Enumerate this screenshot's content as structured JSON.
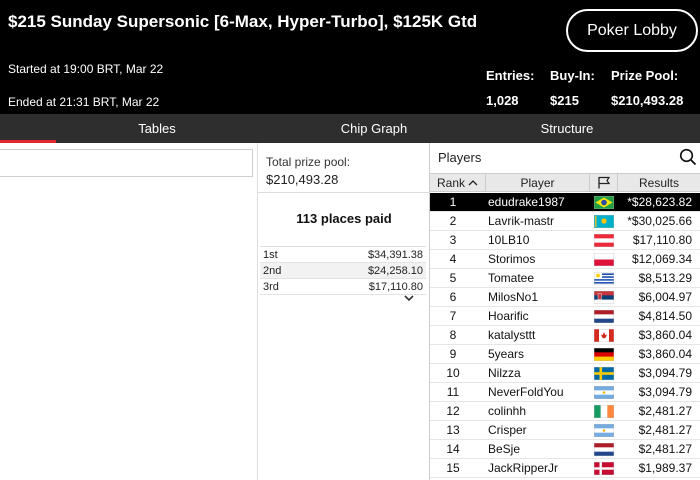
{
  "header": {
    "title": "$215 Sunday Supersonic [6-Max, Hyper-Turbo], $125K Gtd",
    "started": "Started at 19:00 BRT, Mar 22",
    "ended": "Ended at 21:31 BRT, Mar 22",
    "lobby_button": "Poker Lobby",
    "stats": {
      "entries_label": "Entries:",
      "entries_value": "1,028",
      "buyin_label": "Buy-In:",
      "buyin_value": "$215",
      "pool_label": "Prize Pool:",
      "pool_value": "$210,493.28"
    }
  },
  "tabs": [
    "Tables",
    "Chip Graph",
    "Structure"
  ],
  "active_tab": "Tables",
  "prize": {
    "total_label": "Total prize pool:",
    "total_value": "$210,493.28",
    "places_paid": "113 places paid",
    "places": [
      {
        "place": "1st",
        "amount": "$34,391.38"
      },
      {
        "place": "2nd",
        "amount": "$24,258.10"
      },
      {
        "place": "3rd",
        "amount": "$17,110.80"
      }
    ]
  },
  "players": {
    "title": "Players",
    "columns": {
      "rank": "Rank",
      "player": "Player",
      "results": "Results"
    },
    "rows": [
      {
        "rank": "1",
        "name": "edudrake1987",
        "flag": "brazil",
        "result": "*$28,623.82"
      },
      {
        "rank": "2",
        "name": "Lavrik-mastr",
        "flag": "kazakhstan",
        "result": "*$30,025.66"
      },
      {
        "rank": "3",
        "name": "10LB10",
        "flag": "austria",
        "result": "$17,110.80"
      },
      {
        "rank": "4",
        "name": "Storimos",
        "flag": "poland",
        "result": "$12,069.34"
      },
      {
        "rank": "5",
        "name": "Tomatee",
        "flag": "uruguay",
        "result": "$8,513.29"
      },
      {
        "rank": "6",
        "name": "MilosNo1",
        "flag": "serbia",
        "result": "$6,004.97"
      },
      {
        "rank": "7",
        "name": "Hoarific",
        "flag": "netherlands",
        "result": "$4,814.50"
      },
      {
        "rank": "8",
        "name": "katalysttt",
        "flag": "canada",
        "result": "$3,860.04"
      },
      {
        "rank": "9",
        "name": "5years",
        "flag": "germany",
        "result": "$3,860.04"
      },
      {
        "rank": "10",
        "name": "Nilzza",
        "flag": "sweden",
        "result": "$3,094.79"
      },
      {
        "rank": "11",
        "name": "NeverFoldYou",
        "flag": "argentina",
        "result": "$3,094.79"
      },
      {
        "rank": "12",
        "name": "colinhh",
        "flag": "ireland",
        "result": "$2,481.27"
      },
      {
        "rank": "13",
        "name": "Crisper",
        "flag": "argentina",
        "result": "$2,481.27"
      },
      {
        "rank": "14",
        "name": "BeSje",
        "flag": "netherlands",
        "result": "$2,481.27"
      },
      {
        "rank": "15",
        "name": "JackRipperJr",
        "flag": "denmark",
        "result": "$1,989.37"
      }
    ]
  },
  "colors": {
    "header_bg": "#000000",
    "tab_bar_bg": "#2e2e2e",
    "accent_red": "#e3262f",
    "selected_row_bg": "#000000"
  }
}
